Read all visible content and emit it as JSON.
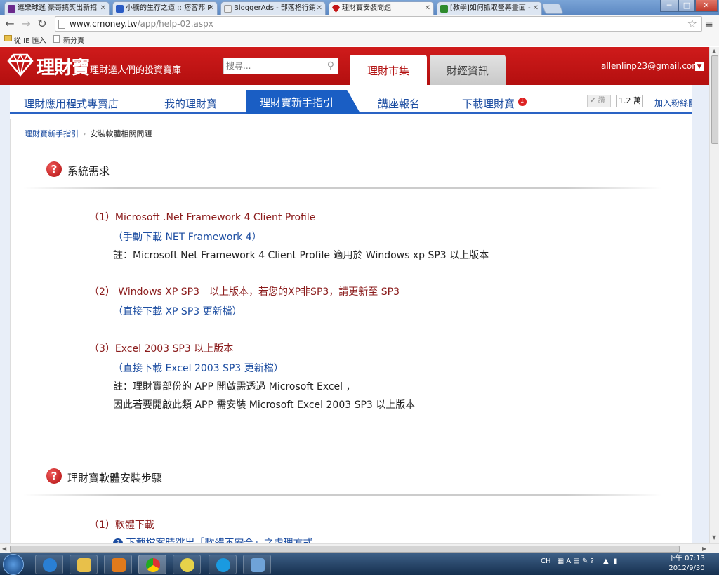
{
  "browser": {
    "tabs": [
      {
        "label": "逗樂球迷 豪哥搞笑出新招",
        "favicon_color": "#6b2a8c"
      },
      {
        "label": "小騰的生存之道 :: 痞客邦 P",
        "favicon_color": "#2a5bc4"
      },
      {
        "label": "BloggerAds - 部落格行銷",
        "favicon_color": "#eeeeee"
      },
      {
        "label": "理財寶安裝問題",
        "favicon_color": "#c41616"
      },
      {
        "label": "[教學]如何抓取螢幕畫面 -",
        "favicon_color": "#2e8b2e"
      }
    ],
    "active_tab_index": 3,
    "window_buttons": [
      "─",
      "□",
      "✕"
    ],
    "url_host": "www.cmoney.tw",
    "url_path": "/app/help-02.aspx",
    "bookmarks": [
      {
        "label": "從 IE 匯入",
        "icon": "folder-icon"
      },
      {
        "label": "新分頁",
        "icon": "page-icon"
      }
    ]
  },
  "site": {
    "brand": "理財寶",
    "slogan": "理財達人們的投資寶庫",
    "search_placeholder": "搜尋...",
    "top_tabs": [
      "理財市集",
      "財經資訊"
    ],
    "user_email": "allenlinp23@gmail.com",
    "subnav": [
      "理財應用程式專賣店",
      "我的理財寶",
      "理財寶新手指引",
      "講座報名",
      "下載理財寶"
    ],
    "like_label": "讚",
    "like_count": "1.2 萬",
    "fans_label": "加入粉絲團",
    "colors": {
      "brand_red": "#c41616",
      "nav_blue": "#1a5ec4",
      "item_red": "#8b1c1c",
      "link_blue": "#1c4da1"
    }
  },
  "content": {
    "breadcrumb": [
      "理財寶新手指引",
      "安裝軟體相關問題"
    ],
    "section1_title": "系統需求",
    "s1": {
      "item1": "（1）Microsoft .Net Framework 4 Client Profile",
      "item1_dl": "（手動下載 NET Framework 4）",
      "item1_note": "註：Microsoft Net Framework 4 Client Profile 適用於 Windows xp SP3 以上版本",
      "item2": "（2） Windows XP SP3　以上版本，若您的XP非SP3，請更新至 SP3",
      "item2_dl": "（直接下載 XP SP3 更新檔）",
      "item3": "（3）Excel 2003 SP3 以上版本",
      "item3_dl": "（直接下載 Excel 2003 SP3 更新檔）",
      "item3_note1": "註：理財寶部份的 APP 開啟需透過 Microsoft Excel ，",
      "item3_note2": "因此若要開啟此類 APP 需安裝 Microsoft Excel 2003 SP3 以上版本"
    },
    "section2_title": "理財寶軟體安裝步驟",
    "s2": {
      "item1": "（1）軟體下載",
      "item1_partial": "下載檔案時跳出「軟體不安全」之處理方式"
    }
  },
  "taskbar": {
    "apps": [
      "ie-icon",
      "explorer-icon",
      "media-player-icon",
      "chrome-icon",
      "qq-icon",
      "skype-icon",
      "control-panel-icon"
    ],
    "active_app_index": 3,
    "ime": "CH",
    "clock_time": "下午 07:13",
    "clock_date": "2012/9/30"
  }
}
